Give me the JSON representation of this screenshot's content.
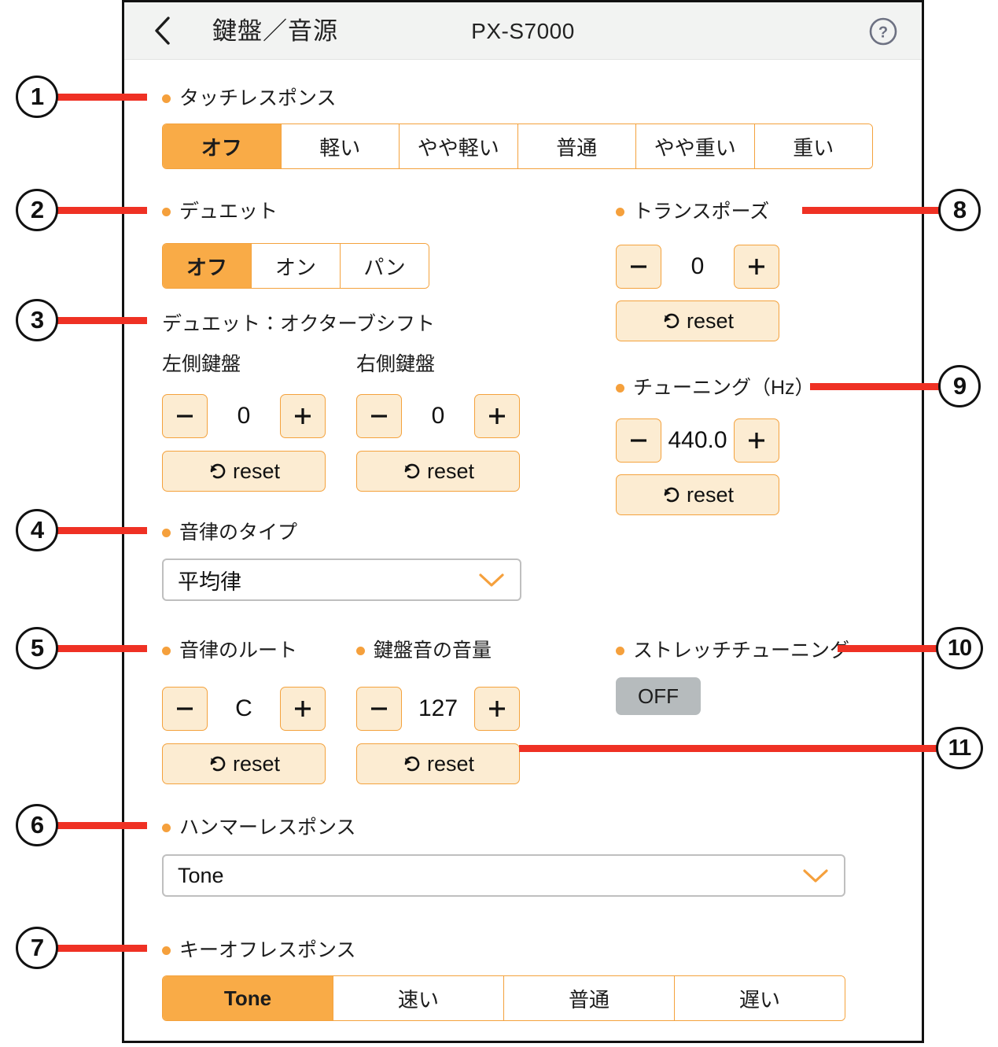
{
  "header": {
    "back_icon": "chevron-left-icon",
    "title": "鍵盤／音源",
    "model": "PX-S7000",
    "help_icon": "help-circle-icon"
  },
  "sections": {
    "touch_response": {
      "label": "タッチレスポンス",
      "options": [
        "オフ",
        "軽い",
        "やや軽い",
        "普通",
        "やや重い",
        "重い"
      ],
      "selected": "オフ"
    },
    "duet": {
      "label": "デュエット",
      "options": [
        "オフ",
        "オン",
        "パン"
      ],
      "selected": "オフ"
    },
    "duet_octave_shift": {
      "label": "デュエット：オクターブシフト",
      "left": {
        "label": "左側鍵盤",
        "value": "0",
        "reset_label": "reset"
      },
      "right": {
        "label": "右側鍵盤",
        "value": "0",
        "reset_label": "reset"
      }
    },
    "temperament_type": {
      "label": "音律のタイプ",
      "value": "平均律"
    },
    "temperament_root": {
      "label": "音律のルート",
      "value": "C",
      "reset_label": "reset"
    },
    "keyboard_volume": {
      "label": "鍵盤音の音量",
      "value": "127",
      "reset_label": "reset"
    },
    "hammer_response": {
      "label": "ハンマーレスポンス",
      "value": "Tone"
    },
    "key_off_response": {
      "label": "キーオフレスポンス",
      "options": [
        "Tone",
        "速い",
        "普通",
        "遅い"
      ],
      "selected": "Tone"
    },
    "transpose": {
      "label": "トランスポーズ",
      "value": "0",
      "reset_label": "reset"
    },
    "tuning": {
      "label": "チューニング（Hz）",
      "value": "440.0",
      "reset_label": "reset"
    },
    "stretch_tuning": {
      "label": "ストレッチチューニング",
      "state": "OFF"
    }
  },
  "callouts": [
    {
      "number": "1"
    },
    {
      "number": "2"
    },
    {
      "number": "3"
    },
    {
      "number": "4"
    },
    {
      "number": "5"
    },
    {
      "number": "6"
    },
    {
      "number": "7"
    },
    {
      "number": "8"
    },
    {
      "number": "9"
    },
    {
      "number": "10"
    },
    {
      "number": "11"
    }
  ],
  "colors": {
    "accent_orange": "#f9ab47",
    "border_orange": "#f4a23d",
    "button_fill": "#fcecd2",
    "callout_red": "#ef3124",
    "toggle_off_gray": "#b6bbbd",
    "header_bg": "#f2f3f2"
  }
}
